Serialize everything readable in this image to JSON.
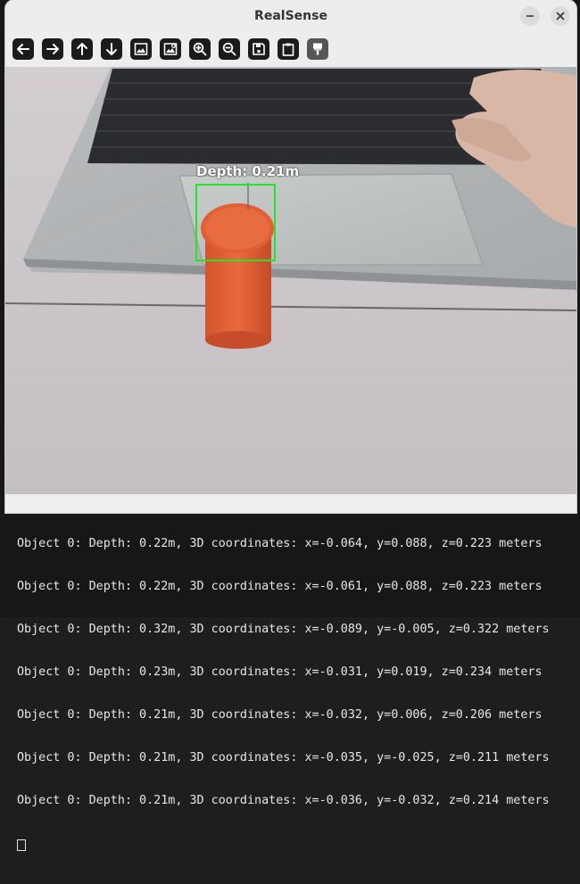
{
  "window": {
    "title": "RealSense"
  },
  "toolbar": {
    "buttons": [
      {
        "name": "back-arrow-icon"
      },
      {
        "name": "forward-arrow-icon"
      },
      {
        "name": "up-arrow-icon"
      },
      {
        "name": "down-arrow-icon"
      },
      {
        "name": "image-icon"
      },
      {
        "name": "image-settings-icon"
      },
      {
        "name": "zoom-in-icon"
      },
      {
        "name": "zoom-out-icon"
      },
      {
        "name": "save-icon"
      },
      {
        "name": "clipboard-icon"
      },
      {
        "name": "paint-brush-icon"
      }
    ]
  },
  "view": {
    "depth_label": "Depth: 0.21m",
    "box_color": "#22e622"
  },
  "terminal": {
    "lines": [
      "Object 0: Depth: 0.22m, 3D coordinates: x=-0.064, y=0.088, z=0.223 meters",
      "Object 0: Depth: 0.22m, 3D coordinates: x=-0.061, y=0.088, z=0.223 meters",
      "Object 0: Depth: 0.32m, 3D coordinates: x=-0.089, y=-0.005, z=0.322 meters",
      "Object 0: Depth: 0.23m, 3D coordinates: x=-0.031, y=0.019, z=0.234 meters",
      "Object 0: Depth: 0.21m, 3D coordinates: x=-0.032, y=0.006, z=0.206 meters",
      "Object 0: Depth: 0.21m, 3D coordinates: x=-0.035, y=-0.025, z=0.211 meters",
      "Object 0: Depth: 0.21m, 3D coordinates: x=-0.036, y=-0.032, z=0.214 meters"
    ]
  }
}
